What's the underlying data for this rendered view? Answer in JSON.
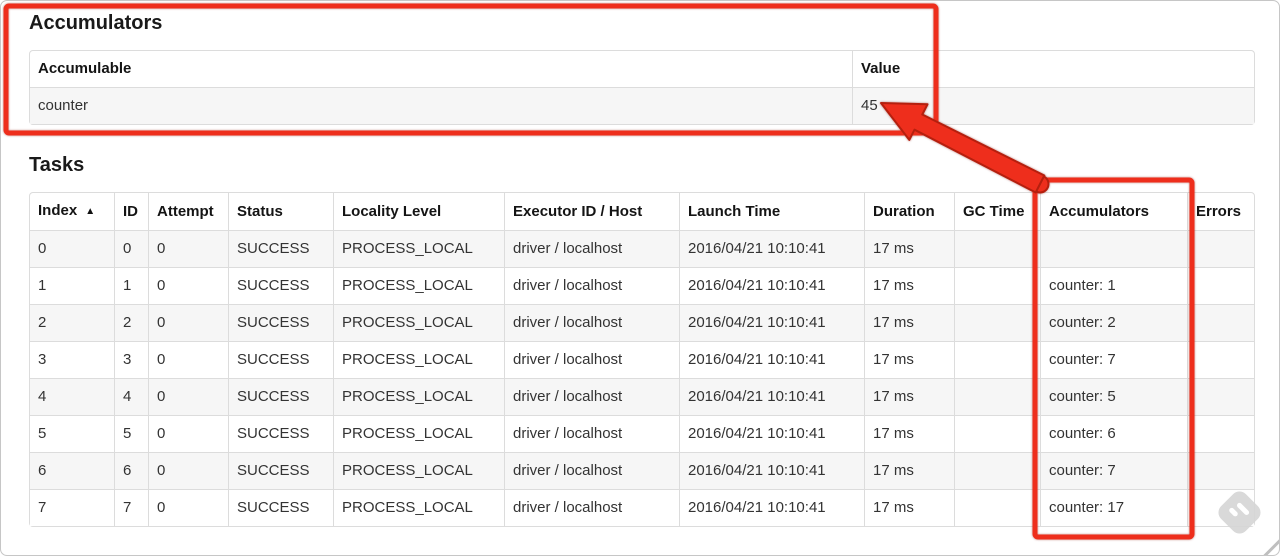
{
  "accumulators_section": {
    "title": "Accumulators",
    "columns": [
      "Accumulable",
      "Value"
    ],
    "rows": [
      {
        "accumulable": "counter",
        "value": "45"
      }
    ]
  },
  "tasks_section": {
    "title": "Tasks",
    "columns": [
      "Index",
      "ID",
      "Attempt",
      "Status",
      "Locality Level",
      "Executor ID / Host",
      "Launch Time",
      "Duration",
      "GC Time",
      "Accumulators",
      "Errors"
    ],
    "sort": {
      "column": "Index",
      "direction": "ascending",
      "icon": "▲"
    },
    "rows": [
      {
        "index": "0",
        "id": "0",
        "attempt": "0",
        "status": "SUCCESS",
        "locality_level": "PROCESS_LOCAL",
        "executor_id_host": "driver / localhost",
        "launch_time": "2016/04/21 10:10:41",
        "duration": "17 ms",
        "gc_time": "",
        "accumulators": "",
        "errors": ""
      },
      {
        "index": "1",
        "id": "1",
        "attempt": "0",
        "status": "SUCCESS",
        "locality_level": "PROCESS_LOCAL",
        "executor_id_host": "driver / localhost",
        "launch_time": "2016/04/21 10:10:41",
        "duration": "17 ms",
        "gc_time": "",
        "accumulators": "counter: 1",
        "errors": ""
      },
      {
        "index": "2",
        "id": "2",
        "attempt": "0",
        "status": "SUCCESS",
        "locality_level": "PROCESS_LOCAL",
        "executor_id_host": "driver / localhost",
        "launch_time": "2016/04/21 10:10:41",
        "duration": "17 ms",
        "gc_time": "",
        "accumulators": "counter: 2",
        "errors": ""
      },
      {
        "index": "3",
        "id": "3",
        "attempt": "0",
        "status": "SUCCESS",
        "locality_level": "PROCESS_LOCAL",
        "executor_id_host": "driver / localhost",
        "launch_time": "2016/04/21 10:10:41",
        "duration": "17 ms",
        "gc_time": "",
        "accumulators": "counter: 7",
        "errors": ""
      },
      {
        "index": "4",
        "id": "4",
        "attempt": "0",
        "status": "SUCCESS",
        "locality_level": "PROCESS_LOCAL",
        "executor_id_host": "driver / localhost",
        "launch_time": "2016/04/21 10:10:41",
        "duration": "17 ms",
        "gc_time": "",
        "accumulators": "counter: 5",
        "errors": ""
      },
      {
        "index": "5",
        "id": "5",
        "attempt": "0",
        "status": "SUCCESS",
        "locality_level": "PROCESS_LOCAL",
        "executor_id_host": "driver / localhost",
        "launch_time": "2016/04/21 10:10:41",
        "duration": "17 ms",
        "gc_time": "",
        "accumulators": "counter: 6",
        "errors": ""
      },
      {
        "index": "6",
        "id": "6",
        "attempt": "0",
        "status": "SUCCESS",
        "locality_level": "PROCESS_LOCAL",
        "executor_id_host": "driver / localhost",
        "launch_time": "2016/04/21 10:10:41",
        "duration": "17 ms",
        "gc_time": "",
        "accumulators": "counter: 7",
        "errors": ""
      },
      {
        "index": "7",
        "id": "7",
        "attempt": "0",
        "status": "SUCCESS",
        "locality_level": "PROCESS_LOCAL",
        "executor_id_host": "driver / localhost",
        "launch_time": "2016/04/21 10:10:41",
        "duration": "17 ms",
        "gc_time": "",
        "accumulators": "counter: 17",
        "errors": ""
      }
    ]
  },
  "annotations": {
    "color": "#ee2e1c"
  },
  "watermark_icon": "skitch-diamond-icon"
}
